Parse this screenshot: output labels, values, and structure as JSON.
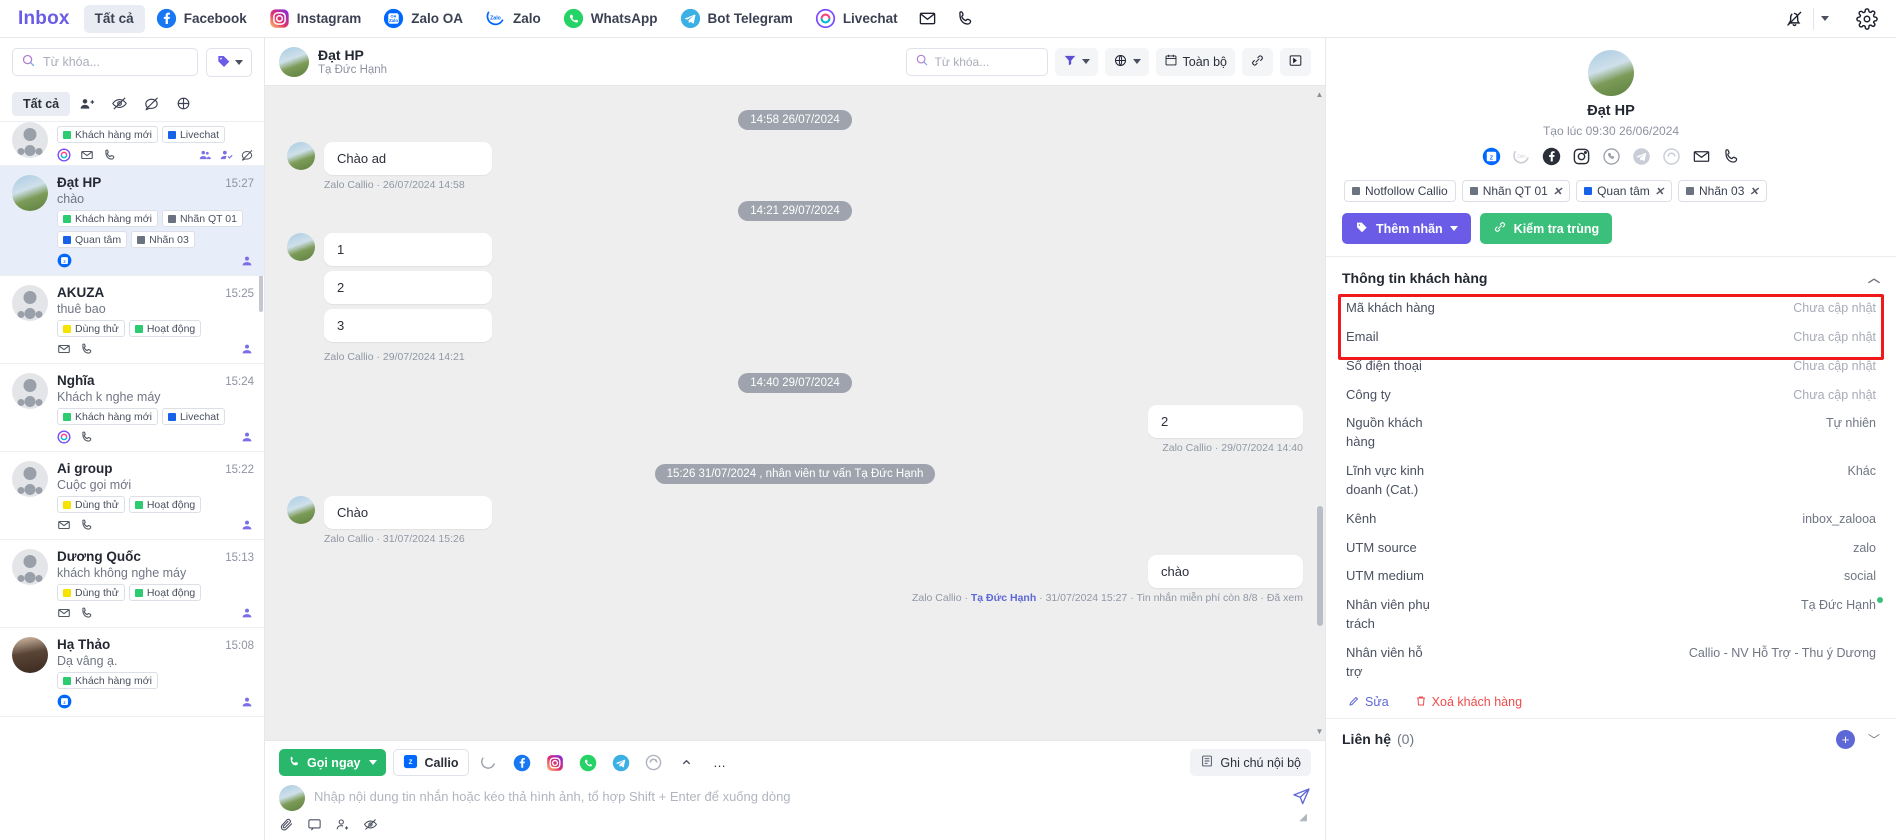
{
  "topbar": {
    "brand": "Inbox",
    "channels": [
      {
        "label": "Tất cả",
        "icon": "none",
        "active": true
      },
      {
        "label": "Facebook",
        "icon": "facebook-icon",
        "active": false
      },
      {
        "label": "Instagram",
        "icon": "instagram-icon",
        "active": false
      },
      {
        "label": "Zalo OA",
        "icon": "zalo-oa-icon",
        "active": false
      },
      {
        "label": "Zalo",
        "icon": "zalo-icon",
        "active": false
      },
      {
        "label": "WhatsApp",
        "icon": "whatsapp-icon",
        "active": false
      },
      {
        "label": "Bot Telegram",
        "icon": "telegram-icon",
        "active": false
      },
      {
        "label": "Livechat",
        "icon": "livechat-icon",
        "active": false
      }
    ],
    "icons": [
      "mail-icon",
      "phone-icon"
    ],
    "right_icons": [
      "bell-off-icon",
      "chevron-down-icon",
      "gear-icon"
    ]
  },
  "left": {
    "search_placeholder": "Từ khóa...",
    "search_value": "",
    "tag_button": "tag-icon",
    "filter_all": "Tất cả",
    "filter_icons": [
      "add-user-icon",
      "eye-off-icon",
      "no-chat-icon",
      "crosshair-icon"
    ],
    "conversations": [
      {
        "name": "",
        "time": "",
        "message": "",
        "clipped": true,
        "tags": [
          {
            "label": "Khách hàng mới",
            "color": "#2ecc71"
          },
          {
            "label": "Livechat",
            "color": "#1763e8"
          }
        ],
        "icons": [
          "livechat-icon",
          "mail-icon",
          "phone-icon"
        ],
        "right_icons": [
          "people-icon",
          "person-check-icon",
          "no-chat-icon"
        ],
        "avatar": "ph",
        "selected": false
      },
      {
        "name": "Đạt HP",
        "time": "15:27",
        "message": "chào",
        "tags": [
          {
            "label": "Khách hàng mới",
            "color": "#2ecc71"
          },
          {
            "label": "Nhãn QT 01",
            "color": "#6b7280"
          },
          {
            "label": "Quan tâm",
            "color": "#1763e8"
          },
          {
            "label": "Nhãn 03",
            "color": "#6b7280"
          }
        ],
        "icons": [
          "zalo-oa-icon"
        ],
        "right_icons": [
          "person-icon"
        ],
        "avatar": "photo1",
        "selected": true
      },
      {
        "name": "AKUZA",
        "time": "15:25",
        "message": "thuê bao",
        "tags": [
          {
            "label": "Dùng thử",
            "color": "#f6e400"
          },
          {
            "label": "Hoạt động",
            "color": "#2ecc71"
          }
        ],
        "icons": [
          "mail-icon",
          "phone-icon"
        ],
        "right_icons": [
          "person-icon"
        ],
        "avatar": "ph",
        "selected": false
      },
      {
        "name": "Nghĩa",
        "time": "15:24",
        "message": "Khách k nghe máy",
        "tags": [
          {
            "label": "Khách hàng mới",
            "color": "#2ecc71"
          },
          {
            "label": "Livechat",
            "color": "#1763e8"
          }
        ],
        "icons": [
          "livechat-icon",
          "phone-icon"
        ],
        "right_icons": [
          "person-icon"
        ],
        "avatar": "ph",
        "selected": false
      },
      {
        "name": "Ai group",
        "time": "15:22",
        "message": "Cuộc gọi mới",
        "tags": [
          {
            "label": "Dùng thử",
            "color": "#f6e400"
          },
          {
            "label": "Hoạt động",
            "color": "#2ecc71"
          }
        ],
        "icons": [
          "mail-icon",
          "phone-icon"
        ],
        "right_icons": [
          "person-icon"
        ],
        "avatar": "ph",
        "selected": false
      },
      {
        "name": "Dương Quốc",
        "time": "15:13",
        "message": "khách không nghe máy",
        "tags": [
          {
            "label": "Dùng thử",
            "color": "#f6e400"
          },
          {
            "label": "Hoạt động",
            "color": "#2ecc71"
          }
        ],
        "icons": [
          "mail-icon",
          "phone-icon"
        ],
        "right_icons": [
          "person-icon"
        ],
        "avatar": "ph",
        "selected": false
      },
      {
        "name": "Hạ Thảo",
        "time": "15:08",
        "message": "Dạ vâng ạ.",
        "tags": [
          {
            "label": "Khách hàng mới",
            "color": "#2ecc71"
          }
        ],
        "icons": [
          "zalo-oa-icon"
        ],
        "right_icons": [
          "person-icon"
        ],
        "avatar": "photo2",
        "selected": false
      }
    ]
  },
  "chat": {
    "header": {
      "name": "Đạt HP",
      "agent": "Tạ Đức Hạnh",
      "search_placeholder": "Từ khóa...",
      "search_value": "",
      "filter_icon": "filter-icon",
      "globe_icon": "globe-icon",
      "date_button": "Toàn bộ",
      "date_icon": "calendar-icon",
      "link_icon": "link-icon",
      "panel_icon": "panel-icon"
    },
    "groups": [
      {
        "divider": "14:58 26/07/2024",
        "messages": [
          {
            "side": "in",
            "texts": [
              "Chào ad"
            ],
            "meta": "Zalo Callio · 26/07/2024 14:58"
          }
        ]
      },
      {
        "divider": "14:21 29/07/2024",
        "messages": [
          {
            "side": "in",
            "texts": [
              "1",
              "2",
              "3"
            ],
            "meta": "Zalo Callio · 29/07/2024 14:21"
          }
        ]
      },
      {
        "divider": "14:40 29/07/2024",
        "messages": [
          {
            "side": "out",
            "texts": [
              "2"
            ],
            "meta": "Zalo Callio · 29/07/2024 14:40"
          }
        ]
      },
      {
        "divider": "15:26 31/07/2024 , nhân viên tư vấn Tạ Đức Hạnh",
        "messages": [
          {
            "side": "in",
            "texts": [
              "Chào"
            ],
            "meta": "Zalo Callio · 31/07/2024 15:26"
          },
          {
            "side": "out",
            "texts": [
              "chào"
            ],
            "meta_pre": "Zalo Callio · ",
            "meta_agent": "Tạ Đức Hạnh",
            "meta_post": " · 31/07/2024 15:27 · Tin nhắn miễn phí còn 8/8 · Đã xem"
          }
        ]
      }
    ],
    "composer": {
      "call_button": "Gọi ngay",
      "callio_button": "Callio",
      "channel_icons": [
        "zalo-icon",
        "facebook-icon",
        "instagram-icon",
        "whatsapp-icon",
        "telegram-icon",
        "livechat-icon",
        "chevron-up-icon",
        "more-icon"
      ],
      "note_button": "Ghi chú nội bộ",
      "note_icon": "note-icon",
      "placeholder": "Nhập nội dung tin nhắn hoặc kéo thả hình ảnh, tổ hợp Shift + Enter để xuống dòng",
      "value": "",
      "bottom_icons": [
        "attach-icon",
        "template-icon",
        "assign-icon",
        "eye-off-icon"
      ],
      "send_icon": "send-icon"
    }
  },
  "right_panel": {
    "name": "Đạt HP",
    "created": "Tạo lúc 09:30 26/06/2024",
    "channel_icons": [
      "zalo-oa-icon",
      "zalo-icon",
      "facebook-icon",
      "instagram-icon",
      "whatsapp-icon",
      "telegram-icon",
      "livechat-icon",
      "mail-icon",
      "phone-icon"
    ],
    "tags": [
      {
        "label": "Notfollow Callio",
        "color": "#6b7280",
        "removable": false
      },
      {
        "label": "Nhãn QT 01",
        "color": "#6b7280",
        "removable": true
      },
      {
        "label": "Quan tâm",
        "color": "#1763e8",
        "removable": true
      },
      {
        "label": "Nhãn 03",
        "color": "#6b7280",
        "removable": true
      }
    ],
    "add_tag_button": "Thêm nhãn",
    "dup_check_button": "Kiểm tra trùng",
    "section_title": "Thông tin khách hàng",
    "fields": [
      {
        "key": "Mã khách hàng",
        "value": "Chưa cập nhật",
        "muted": true,
        "highlight": true
      },
      {
        "key": "Email",
        "value": "Chưa cập nhật",
        "muted": true,
        "highlight": true
      },
      {
        "key": "Số điện thoại",
        "value": "Chưa cập nhật",
        "muted": true,
        "highlight": true
      },
      {
        "key": "Công ty",
        "value": "Chưa cập nhật",
        "muted": true
      },
      {
        "key": "Nguồn khách hàng",
        "value": "Tự nhiên",
        "muted": false
      },
      {
        "key": "Lĩnh vực kinh doanh (Cat.)",
        "value": "Khác",
        "muted": false
      },
      {
        "key": "Kênh",
        "value": "inbox_zalooa",
        "muted": false
      },
      {
        "key": "UTM source",
        "value": "zalo",
        "muted": false
      },
      {
        "key": "UTM medium",
        "value": "social",
        "muted": false
      },
      {
        "key": "Nhân viên phụ trách",
        "value": "Tạ Đức Hạnh",
        "muted": false,
        "online": true
      },
      {
        "key": "Nhân viên hỗ trợ",
        "value": "Callio - NV Hỗ Trợ - Thu ý Dương",
        "muted": false
      }
    ],
    "edit_action": "Sửa",
    "delete_action": "Xoá khách hàng",
    "contacts_title": "Liên hệ",
    "contacts_count": "(0)"
  },
  "colors": {
    "brand_purple": "#6b5ce7",
    "green": "#3ac07b",
    "highlight_red": "#f01a1a",
    "selected_row": "#e8eef9"
  }
}
